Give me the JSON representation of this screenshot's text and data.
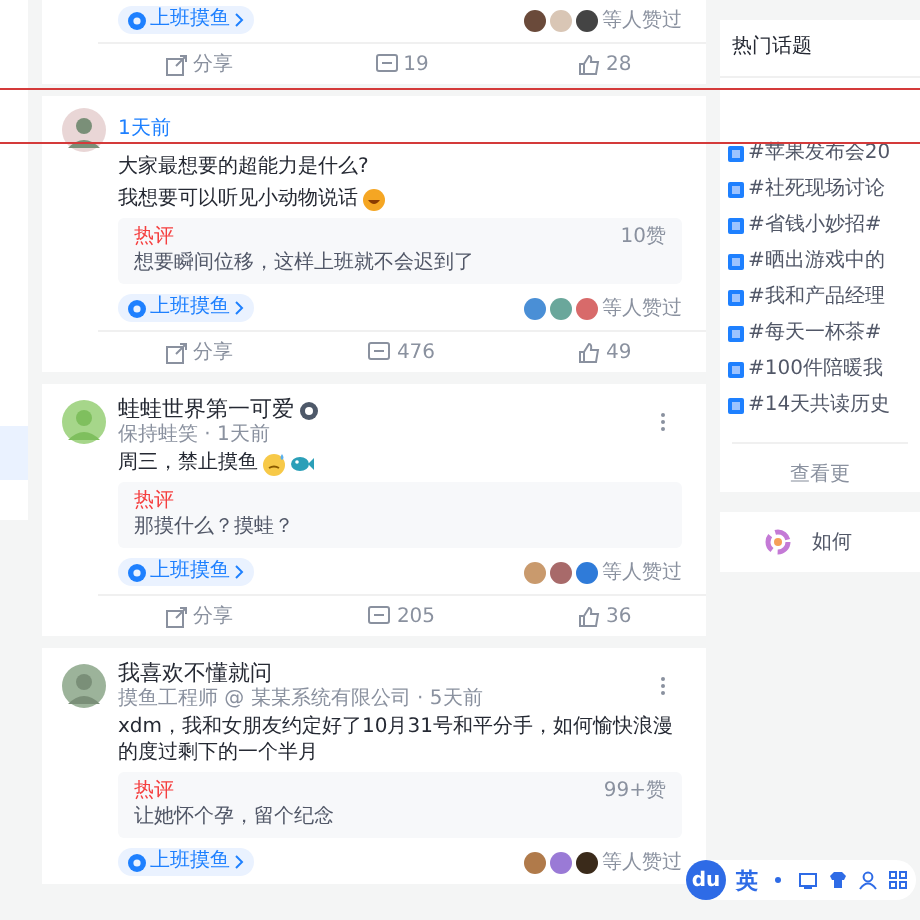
{
  "sidebar": {
    "items": [
      {
        "selected": true
      }
    ]
  },
  "posts": [
    {
      "topic_tag": "上班摸鱼",
      "likers_text": "等人赞过",
      "actions": {
        "share": "分享",
        "comments": "19",
        "likes": "28"
      }
    },
    {
      "time": "1天前",
      "content": [
        "大家最想要的超能力是什么?",
        "我想要可以听见小动物说话"
      ],
      "hot_comment": {
        "label": "热评",
        "likes": "10赞",
        "text": "想要瞬间位移，这样上班就不会迟到了"
      },
      "topic_tag": "上班摸鱼",
      "likers_text": "等人赞过",
      "actions": {
        "share": "分享",
        "comments": "476",
        "likes": "49"
      }
    },
    {
      "author": "蛙蛙世界第一可爱",
      "verified": true,
      "meta": "保持蛙笑 · 1天前",
      "content": [
        "周三，禁止摸鱼"
      ],
      "hot_comment": {
        "label": "热评",
        "text": "那摸什么？摸蛙？"
      },
      "topic_tag": "上班摸鱼",
      "likers_text": "等人赞过",
      "actions": {
        "share": "分享",
        "comments": "205",
        "likes": "36"
      }
    },
    {
      "author": "我喜欢不懂就问",
      "meta": "摸鱼工程师 @ 某某系统有限公司 · 5天前",
      "content": [
        "xdm，我和女朋友约定好了10月31号和平分手，如何愉快浪漫的度过剩下的一个半月"
      ],
      "hot_comment": {
        "label": "热评",
        "likes": "99+赞",
        "text": "让她怀个孕，留个纪念"
      },
      "topic_tag": "上班摸鱼",
      "likers_text": "等人赞过"
    }
  ],
  "hot_topics": {
    "title": "热门话题",
    "items": [
      "#苹果发布会20",
      "#社死现场讨论",
      "#省钱小妙招#",
      "#晒出游戏中的",
      "#我和产品经理",
      "#每天一杯茶#",
      "#100件陪暖我",
      "#14天共读历史"
    ],
    "more": "查看更"
  },
  "promo": {
    "text": "如何"
  },
  "ime_bar": {
    "logo": "du",
    "mode": "英"
  }
}
